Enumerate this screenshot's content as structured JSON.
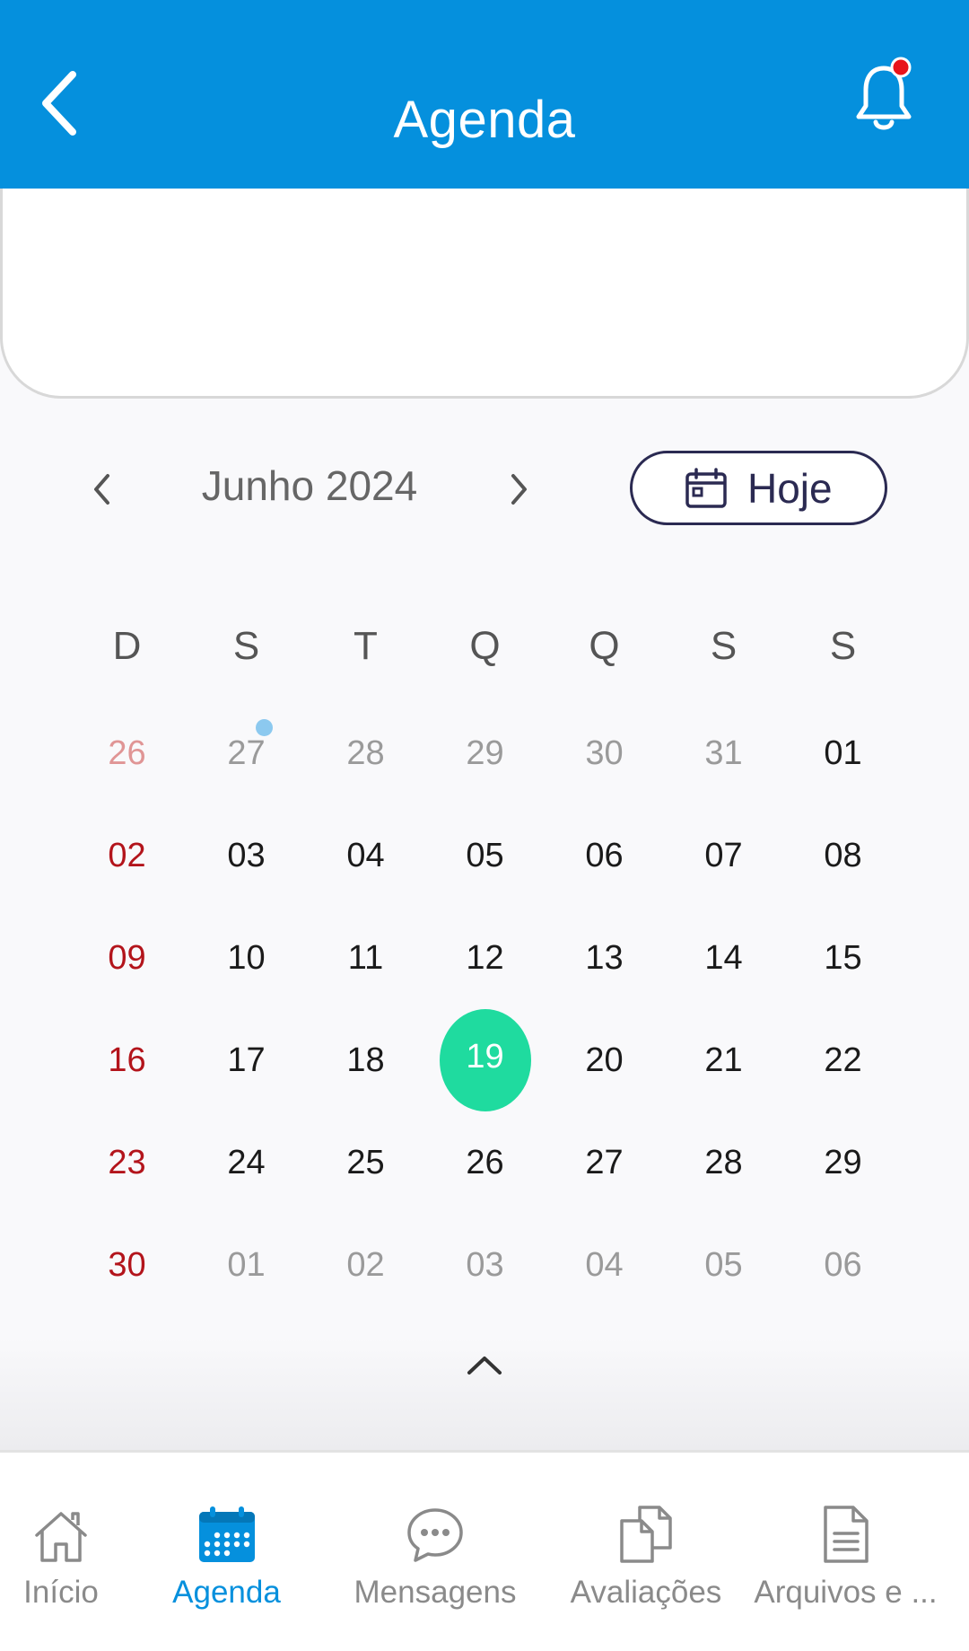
{
  "header": {
    "title": "Agenda",
    "has_notification": true
  },
  "calendar": {
    "month_label": "Junho 2024",
    "today_label": "Hoje",
    "weekdays": [
      "D",
      "S",
      "T",
      "Q",
      "Q",
      "S",
      "S"
    ],
    "weeks": [
      [
        "26",
        "27",
        "28",
        "29",
        "30",
        "31",
        "01"
      ],
      [
        "02",
        "03",
        "04",
        "05",
        "06",
        "07",
        "08"
      ],
      [
        "09",
        "10",
        "11",
        "12",
        "13",
        "14",
        "15"
      ],
      [
        "16",
        "17",
        "18",
        "19",
        "20",
        "21",
        "22"
      ],
      [
        "23",
        "24",
        "25",
        "26",
        "27",
        "28",
        "29"
      ],
      [
        "30",
        "01",
        "02",
        "03",
        "04",
        "05",
        "06"
      ]
    ],
    "today": "19",
    "event_day": "27"
  },
  "bottom_nav": {
    "items": [
      {
        "label": "Início",
        "icon": "home-icon"
      },
      {
        "label": "Agenda",
        "icon": "calendar-icon"
      },
      {
        "label": "Mensagens",
        "icon": "chat-icon"
      },
      {
        "label": "Avaliações",
        "icon": "documents-icon"
      },
      {
        "label": "Arquivos e ...",
        "icon": "file-icon"
      }
    ],
    "active": "Agenda"
  },
  "colors": {
    "header": "#0590dd",
    "today_highlight": "#1fdb9f",
    "sunday": "#b3141b",
    "event_dot": "#8cc9ef",
    "active_nav": "#0590dd"
  }
}
